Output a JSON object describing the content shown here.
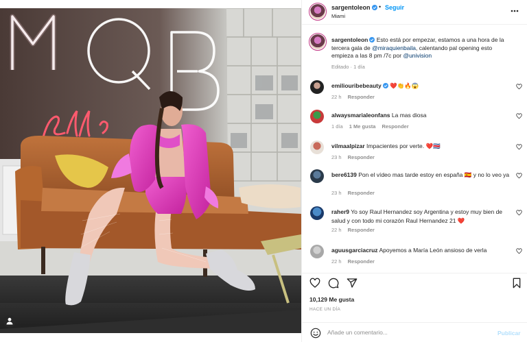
{
  "post": {
    "username": "sargentoleon",
    "follow_label": "Seguir",
    "dot": "•",
    "location": "Miami",
    "caption_prefix": "Esto está por empezar, estamos a una hora de la tercera gala de",
    "caption_mention1": "@miraquienbaila",
    "caption_middle": ", calentando pal opening esto empieza a las 8 pm /7c por",
    "caption_mention2": "@univision",
    "caption_meta": "Editado · 1 día",
    "photo_sign_top": "MQB",
    "photo_sign_script": "All S"
  },
  "comments": [
    {
      "user": "emiliouribebeauty",
      "verified": true,
      "text": "❤️👏🔥😱",
      "time": "22 h",
      "likes": "",
      "reply": "Responder"
    },
    {
      "user": "alwaysmarialeonfans",
      "verified": false,
      "text": "La mas diosa",
      "time": "1 día",
      "likes": "1 Me gusta",
      "reply": "Responder"
    },
    {
      "user": "vilmaalpizar",
      "verified": false,
      "text": "Impacientes por verte. ❤️🇨🇷",
      "time": "23 h",
      "likes": "",
      "reply": "Responder"
    },
    {
      "user": "bere6139",
      "verified": false,
      "text": "Pon el vídeo mas tarde estoy en españa 🇪🇸 y no lo veo ya",
      "time": "23 h",
      "likes": "",
      "reply": "Responder"
    },
    {
      "user": "raher9",
      "verified": false,
      "text": "Yo soy Raul Hernandez soy Argentina y estoy muy bien de salud y con todo mi corazón Raul Hernandez 21 ❤️",
      "time": "22 h",
      "likes": "",
      "reply": "Responder"
    },
    {
      "user": "aguusgarciacruz",
      "verified": false,
      "text": "Apoyemos a María León ansioso de verla",
      "time": "22 h",
      "likes": "",
      "reply": "Responder"
    }
  ],
  "engagement": {
    "likes_label": "10,129 Me gusta",
    "ago_label": "HACE UN DÍA"
  },
  "add_comment": {
    "placeholder": "Añade un comentario...",
    "post_label": "Publicar"
  },
  "icons": {
    "like": "heart-icon",
    "comment": "comment-icon",
    "share": "share-icon",
    "save": "bookmark-icon",
    "more": "more-icon",
    "emoji": "emoji-icon",
    "tag": "user-tag-icon"
  },
  "colors": {
    "accent": "#0095f6",
    "verified": "#3897f0",
    "heart_red": "#ed4956",
    "outfit_pink": "#e040c0",
    "neon_red": "#e53950"
  }
}
